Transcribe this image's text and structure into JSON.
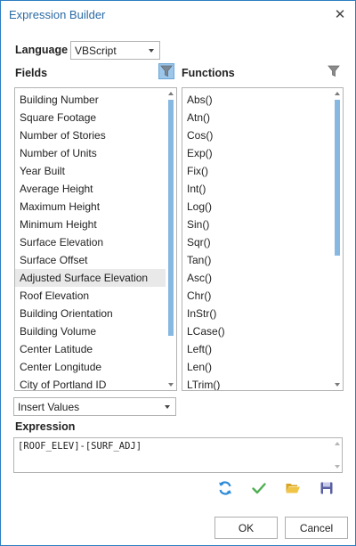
{
  "window": {
    "title": "Expression Builder",
    "close_glyph": "✕"
  },
  "language": {
    "label": "Language",
    "selected": "VBScript"
  },
  "fields": {
    "header": "Fields",
    "items": [
      "Building Number",
      "Square Footage",
      "Number of Stories",
      "Number of Units",
      "Year Built",
      "Average Height",
      "Maximum Height",
      "Minimum Height",
      "Surface Elevation",
      "Surface Offset",
      "Adjusted Surface Elevation",
      "Roof Elevation",
      "Building Orientation",
      "Building Volume",
      "Center Latitude",
      "Center Longitude",
      "City of Portland ID"
    ],
    "selected_item": "Adjusted Surface Elevation"
  },
  "functions": {
    "header": "Functions",
    "items": [
      "Abs()",
      "Atn()",
      "Cos()",
      "Exp()",
      "Fix()",
      "Int()",
      "Log()",
      "Sin()",
      "Sqr()",
      "Tan()",
      "Asc()",
      "Chr()",
      "InStr()",
      "LCase()",
      "Left()",
      "Len()",
      "LTrim()"
    ]
  },
  "insert_values": {
    "selected": "Insert Values"
  },
  "expression": {
    "label": "Expression",
    "value": "[ROOF_ELEV]-[SURF_ADJ]"
  },
  "toolbar": {
    "icons": [
      "refresh-icon",
      "checkmark-icon",
      "folder-open-icon",
      "save-icon"
    ]
  },
  "buttons": {
    "ok": "OK",
    "cancel": "Cancel"
  },
  "colors": {
    "accent": "#2d7dbf",
    "title_text": "#2c6aa3",
    "filter_active_bg": "#9cc6ea",
    "scroll_thumb": "#86b8e2",
    "selection_bg": "#e9e9e9",
    "check_green": "#4caf50",
    "folder_yellow": "#e8b830",
    "save_purple": "#5a5fa3",
    "refresh_blue": "#2b8ad8"
  }
}
